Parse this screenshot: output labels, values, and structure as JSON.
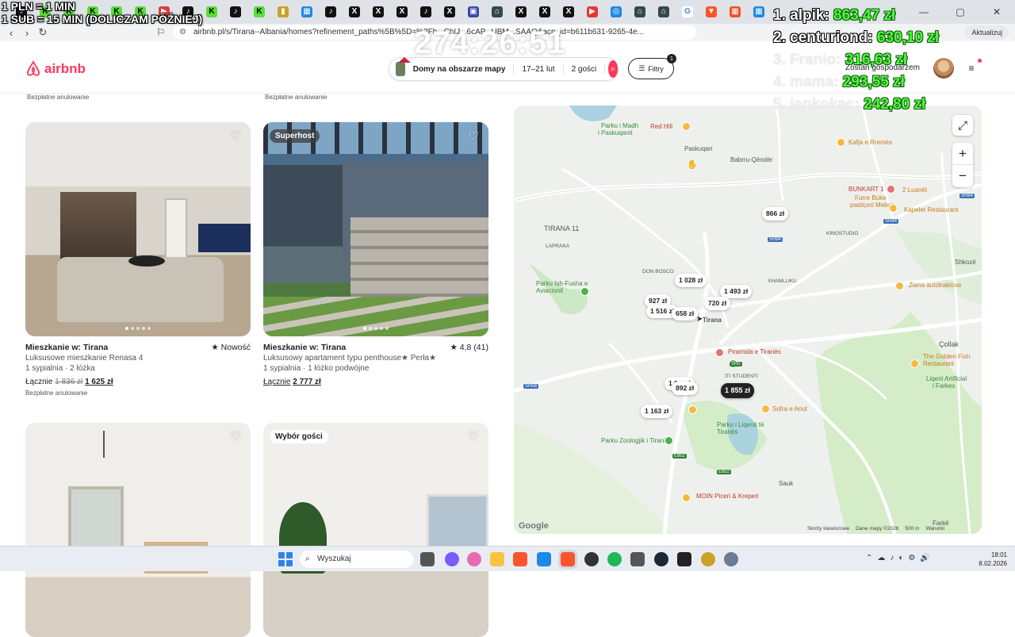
{
  "browser": {
    "url": "airbnb.pl/s/Tirana--Albania/homes?refinement_paths%5B%5D=%2Fh...ChIJ...6cAP...UBM...SAAQ&acp_id=b611b631-9265-4e...",
    "update_button": "Aktualizuj"
  },
  "overlay": {
    "rate_line_1": "1 PLN = 1 MIN",
    "rate_line_2": "1 SUB = 15 MIN (DOLICZAM PÓŹNIEJ)",
    "timer": "274:26:51",
    "leaderboard": [
      {
        "name": "1. alpik:",
        "amount": "863,47 zł"
      },
      {
        "name": "2. centuriond:",
        "amount": "630,10 zł"
      },
      {
        "name": "3. Franio:",
        "amount": "316,63 zł"
      },
      {
        "name": "4. mama:",
        "amount": "293,55 zł"
      },
      {
        "name": "5. jankokac:",
        "amount": "242,80 zł"
      }
    ]
  },
  "header": {
    "logo_text": "airbnb",
    "search_location": "Domy na obszarze mapy",
    "search_dates": "17–21 lut",
    "search_guests": "2 gości",
    "filters_label": "Filtry",
    "filters_count": "1",
    "host_link": "Zostań gospodarzem"
  },
  "listings": {
    "top_free_cancel_1": "Bezpłatne anulowanie",
    "top_free_cancel_2": "Bezpłatne anulowanie",
    "cards": [
      {
        "title": "Mieszkanie w: Tirana",
        "rating": "★ Nowość",
        "subtitle": "Luksusowe mieszkanie Renasa 4",
        "details": "1 sypialnia · 2 łóżka",
        "price_prefix": "Łącznie",
        "price_old": "1 836 zł",
        "price_new": "1 625 zł",
        "free_cancel": "Bezpłatne anulowanie",
        "badge": ""
      },
      {
        "title": "Mieszkanie w: Tirana",
        "rating": "★ 4,8 (41)",
        "subtitle": "Luksusowy apartament typu penthouse★ Perła★",
        "details": "1 sypialnia · 1 łóżko podwójne",
        "price_prefix": "Łącznie",
        "price_old": "",
        "price_new": "2 777 zł",
        "free_cancel": "",
        "badge": "Superhost"
      },
      {
        "badge": ""
      },
      {
        "badge": "Wybór gości"
      }
    ]
  },
  "map": {
    "pins": [
      {
        "label": "866 zł",
        "active": false
      },
      {
        "label": "1 028 zł",
        "active": false
      },
      {
        "label": "1 493 zł",
        "active": false
      },
      {
        "label": "927 zł",
        "active": false
      },
      {
        "label": "720 zł",
        "active": false
      },
      {
        "label": "1 516 zł",
        "active": false
      },
      {
        "label": "658 zł",
        "active": false
      },
      {
        "label": "1 0... zł",
        "active": false
      },
      {
        "label": "892 zł",
        "active": false
      },
      {
        "label": "1 855 zł",
        "active": true
      },
      {
        "label": "1 163 zł",
        "active": false
      }
    ],
    "labels": {
      "red_hill": "Red Hill",
      "parku_madh": "Parku i Madh",
      "paskuqanit": "i Paskuqanit",
      "paskuqan": "Paskuqan",
      "babrru": "Babrru-Qëndër",
      "kafja": "Kafja e Rremës",
      "bunkart": "BUNKART 1",
      "luanet": "2 Luanët",
      "furre": "Furre Buke",
      "melisa": "pastiçeri Melisa",
      "kapelet": "Kapelet Restaurant",
      "tirana11": "TIRANA 11",
      "laprakа": "LAPRAKA",
      "kinostudio": "KINOSTUDIO",
      "shkoze": "Shkozë",
      "don_bosco": "DON BOSCO",
      "xhamlliku": "XHAMLLIKU",
      "ish_fusha": "Parku Ish-Fusha e Aviacionit",
      "ziana": "Ziana autotraktove",
      "tirana": "Tirana",
      "piramida": "Piramida e Tiranës",
      "studenti": "ITI STUDENTI",
      "golden": "The Golden Fish Restaurant",
      "liqeni_art": "Liqeni Artificial",
      "farkes": "i Farkes",
      "collak": "Çollak",
      "sofra": "Sofra e Anut",
      "park_lake": "Parku i Liqenit të Tiranës",
      "zoo": "Parku Zoologjik i Tiranës",
      "sauk": "Sauk",
      "moin": "MOIN Piceri & Kreperi",
      "farke": "Farkë"
    },
    "road_shields": [
      "SH84",
      "SH84",
      "SH84",
      "SH2",
      "SH56",
      "E852",
      "E852"
    ],
    "footer": {
      "shortcuts": "Skróty klawiszowe",
      "data": "Dane mapy ©2026",
      "scale": "500 m",
      "terms": "Warunki"
    },
    "google": "Google"
  },
  "taskbar": {
    "search_placeholder": "Wyszukaj",
    "time": "18:01",
    "date": "8.02.2026"
  }
}
